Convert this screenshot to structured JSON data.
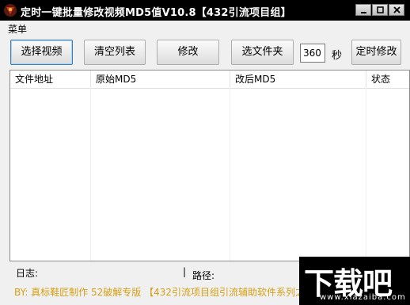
{
  "window": {
    "title": "定时一键批量修改视频MD5值V10.8【432引流项目组】"
  },
  "menu": {
    "label": "菜单"
  },
  "toolbar": {
    "select_video": "选择视频",
    "clear_list": "清空列表",
    "modify": "修改",
    "select_folder": "选文件夹",
    "seconds_value": "360",
    "seconds_unit": "秒",
    "timed_modify": "定时修改"
  },
  "table": {
    "columns": [
      "文件地址",
      "原始MD5",
      "改后MD5",
      "状态"
    ],
    "rows": []
  },
  "status": {
    "log_label": "日志:",
    "divider": "|",
    "path_label": "路径:"
  },
  "credits": "BY: 真标鞋匠制作 52破解专版 【432引流项目组引流辅助软件系列之",
  "watermark": {
    "logo": "下载吧",
    "url": "www.xiazaiba.com"
  },
  "colors": {
    "titlebar": "#000000",
    "credits": "#d4a017",
    "focus_border": "#3c7fb1"
  }
}
